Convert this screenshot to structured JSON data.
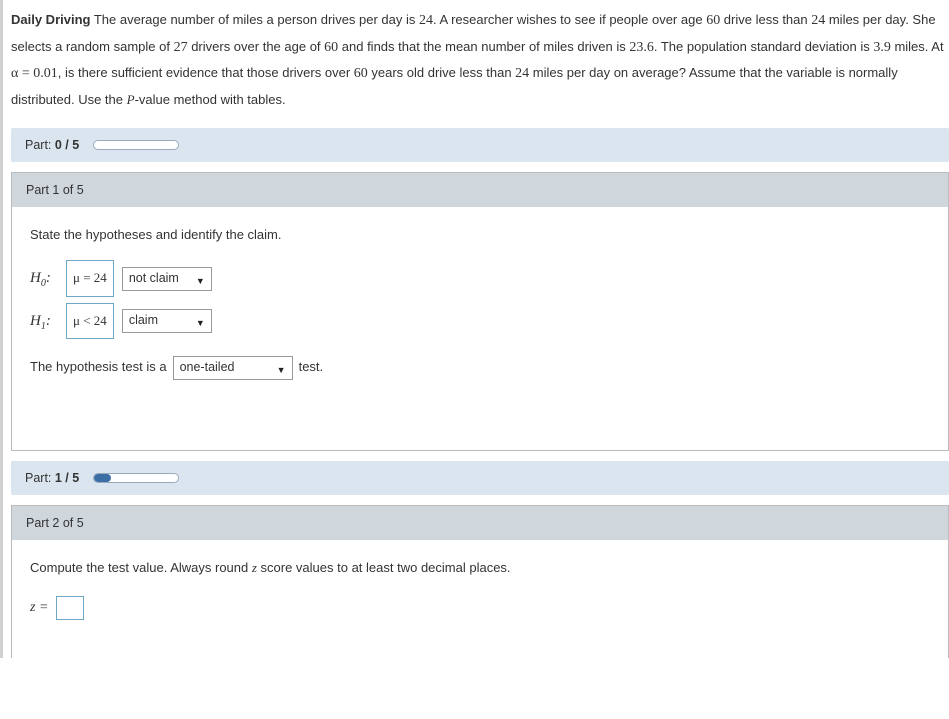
{
  "problem": {
    "title": "Daily Driving",
    "body_1": " The average number of miles a person drives per day is ",
    "n1": "24",
    "body_2": ". A researcher wishes to see if people over age ",
    "n2": "60",
    "body_3": " drive less than ",
    "n3": "24",
    "body_4": " miles per day. She selects a random sample of ",
    "n4": "27",
    "body_5": " drivers over the age of ",
    "n5": "60",
    "body_6": " and finds that the mean number of miles driven is ",
    "n6": "23.6",
    "body_7": ". The population standard deviation is ",
    "n7": "3.9",
    "body_8": " miles. At ",
    "alpha_sym": "α = 0.01",
    "body_9": ", is there sufficient evidence that those drivers over ",
    "n8": "60",
    "body_10": " years old drive less than ",
    "n9": "24",
    "body_11": " miles per day on average? Assume that the variable is normally distributed. Use the ",
    "pval": "P",
    "body_12": "-value method with tables."
  },
  "progress0": {
    "label_prefix": "Part: ",
    "label_value": "0 / 5",
    "fill_pct": 0
  },
  "part1": {
    "header": "Part 1 of 5",
    "instruction": "State the hypotheses and identify the claim.",
    "h0_label": "H",
    "h0_sub": "0",
    "h0_colon": ":",
    "h0_box": "μ = 24",
    "h0_claim": "not claim",
    "h1_label": "H",
    "h1_sub": "1",
    "h1_colon": ":",
    "h1_box": "μ < 24",
    "h1_claim": "claim",
    "sentence_pre": "The hypothesis test is a",
    "tail_sel": "one-tailed",
    "sentence_post": "test."
  },
  "progress1": {
    "label_prefix": "Part: ",
    "label_value": "1 / 5",
    "fill_pct": 20
  },
  "part2": {
    "header": "Part 2 of 5",
    "instruction_a": "Compute the test value. Always round ",
    "instruction_z": "z",
    "instruction_b": " score values to at least two decimal places.",
    "z_label": "z =",
    "z_value": ""
  }
}
